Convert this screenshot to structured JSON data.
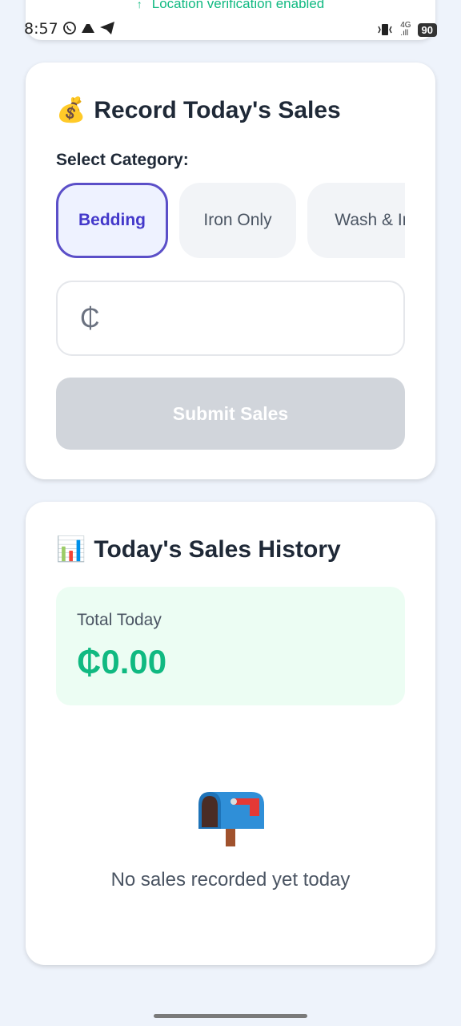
{
  "banner": {
    "location_text": "Location verification enabled"
  },
  "status_bar": {
    "time": "8:57",
    "network": "4G",
    "battery": "90"
  },
  "record_card": {
    "title": "Record Today's Sales",
    "title_emoji": "💰",
    "select_label": "Select Category:",
    "categories": [
      {
        "label": "Bedding",
        "selected": true
      },
      {
        "label": "Iron Only",
        "selected": false
      },
      {
        "label": "Wash & Ir",
        "selected": false
      }
    ],
    "amount_prefix": "₵",
    "amount_value": "",
    "submit_label": "Submit Sales"
  },
  "history_card": {
    "title": "Today's Sales History",
    "title_emoji": "📊",
    "total_label": "Total Today",
    "total_value": "₵0.00",
    "empty_message": "No sales recorded yet today"
  },
  "colors": {
    "accent": "#5b4fc8",
    "success": "#10b981",
    "background": "#eef3fb"
  }
}
